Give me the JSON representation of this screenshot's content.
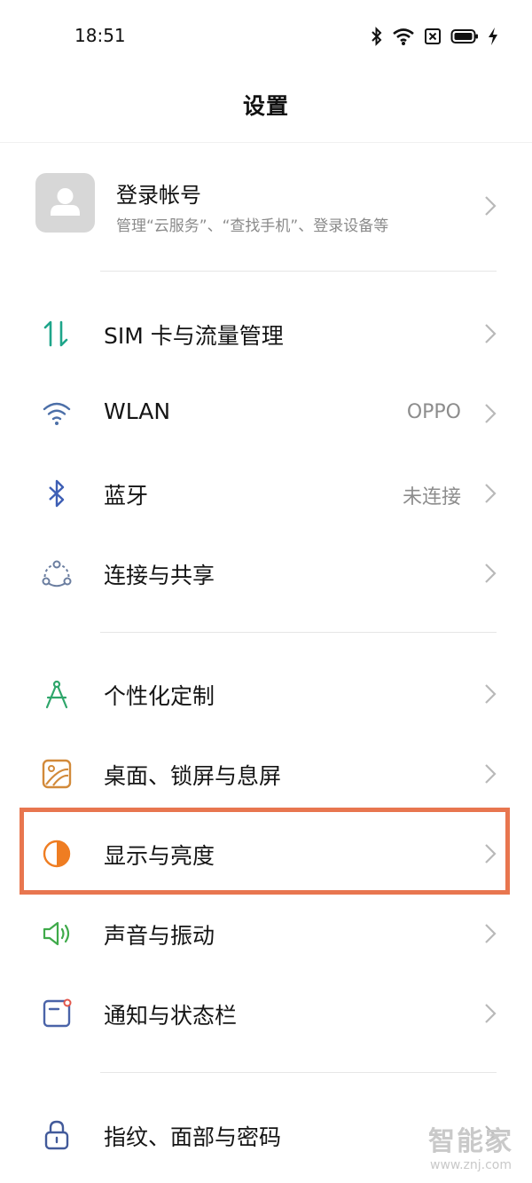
{
  "status_bar": {
    "time": "18:51",
    "icons": [
      "bluetooth-icon",
      "wifi-icon",
      "sim-off-icon",
      "battery-icon",
      "charging-icon"
    ]
  },
  "header": {
    "title": "设置"
  },
  "account": {
    "title": "登录帐号",
    "subtitle": "管理“云服务”、“查找手机”、登录设备等"
  },
  "settings": {
    "items": [
      {
        "label": "SIM 卡与流量管理",
        "value": "",
        "icon": "sim-data-icon",
        "color": "#1ea58a"
      },
      {
        "label": "WLAN",
        "value": "OPPO",
        "icon": "wifi-icon",
        "color": "#4c6fa8"
      },
      {
        "label": "蓝牙",
        "value": "未连接",
        "icon": "bluetooth-icon",
        "color": "#3e5fb5"
      },
      {
        "label": "连接与共享",
        "value": "",
        "icon": "share-icon",
        "color": "#6b7ea0"
      },
      {
        "label": "个性化定制",
        "value": "",
        "icon": "compass-icon",
        "color": "#2fa66b"
      },
      {
        "label": "桌面、锁屏与息屏",
        "value": "",
        "icon": "wallpaper-icon",
        "color": "#d28a3a"
      },
      {
        "label": "显示与亮度",
        "value": "",
        "icon": "brightness-icon",
        "color": "#ef7d22",
        "highlighted": true
      },
      {
        "label": "声音与振动",
        "value": "",
        "icon": "speaker-icon",
        "color": "#3faa4a"
      },
      {
        "label": "通知与状态栏",
        "value": "",
        "icon": "notification-icon",
        "color": "#4a63a8"
      },
      {
        "label": "指纹、面部与密码",
        "value": "",
        "icon": "lock-icon",
        "color": "#425a9a"
      }
    ]
  },
  "highlight_color": "#e8764f",
  "watermark": {
    "brand": "智能家",
    "url": "www.znj.com"
  }
}
